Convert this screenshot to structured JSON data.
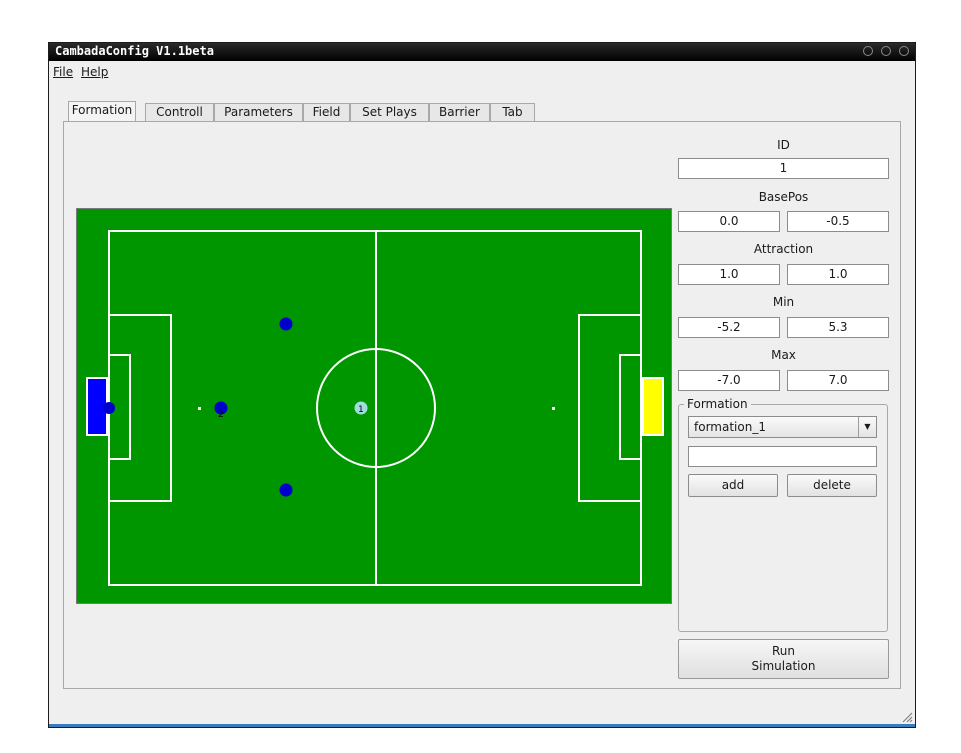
{
  "window": {
    "title": "CambadaConfig V1.1beta"
  },
  "menu": {
    "file": "File",
    "help": "Help"
  },
  "tabs": [
    {
      "label": "Formation",
      "active": true
    },
    {
      "label": "Controll",
      "active": false
    },
    {
      "label": "Parameters",
      "active": false
    },
    {
      "label": "Field",
      "active": false
    },
    {
      "label": "Set Plays",
      "active": false
    },
    {
      "label": "Barrier",
      "active": false
    },
    {
      "label": "Tab",
      "active": false
    }
  ],
  "field": {
    "grass_color": "#009600",
    "line_color": "#ffffff",
    "left_goal_color": "#0000ff",
    "right_goal_color": "#ffff00",
    "robot_color": "#0000cc",
    "selected_robot_color": "#a0dcdc",
    "robots": [
      {
        "label": "1",
        "selected": true
      },
      {
        "label": "2",
        "selected": false
      },
      {
        "label": "",
        "selected": false
      },
      {
        "label": "",
        "selected": false
      },
      {
        "label": "",
        "selected": false
      }
    ]
  },
  "properties": {
    "id_label": "ID",
    "id_value": "1",
    "basepos_label": "BasePos",
    "basepos_x": "0.0",
    "basepos_y": "-0.5",
    "attraction_label": "Attraction",
    "attraction_x": "1.0",
    "attraction_y": "1.0",
    "min_label": "Min",
    "min_x": "-5.2",
    "min_y": "5.3",
    "max_label": "Max",
    "max_x": "-7.0",
    "max_y": "7.0"
  },
  "formation_group": {
    "title": "Formation",
    "selected": "formation_1",
    "name_input": "",
    "add_label": "add",
    "delete_label": "delete"
  },
  "run_button": {
    "line1": "Run",
    "line2": "Simulation"
  }
}
